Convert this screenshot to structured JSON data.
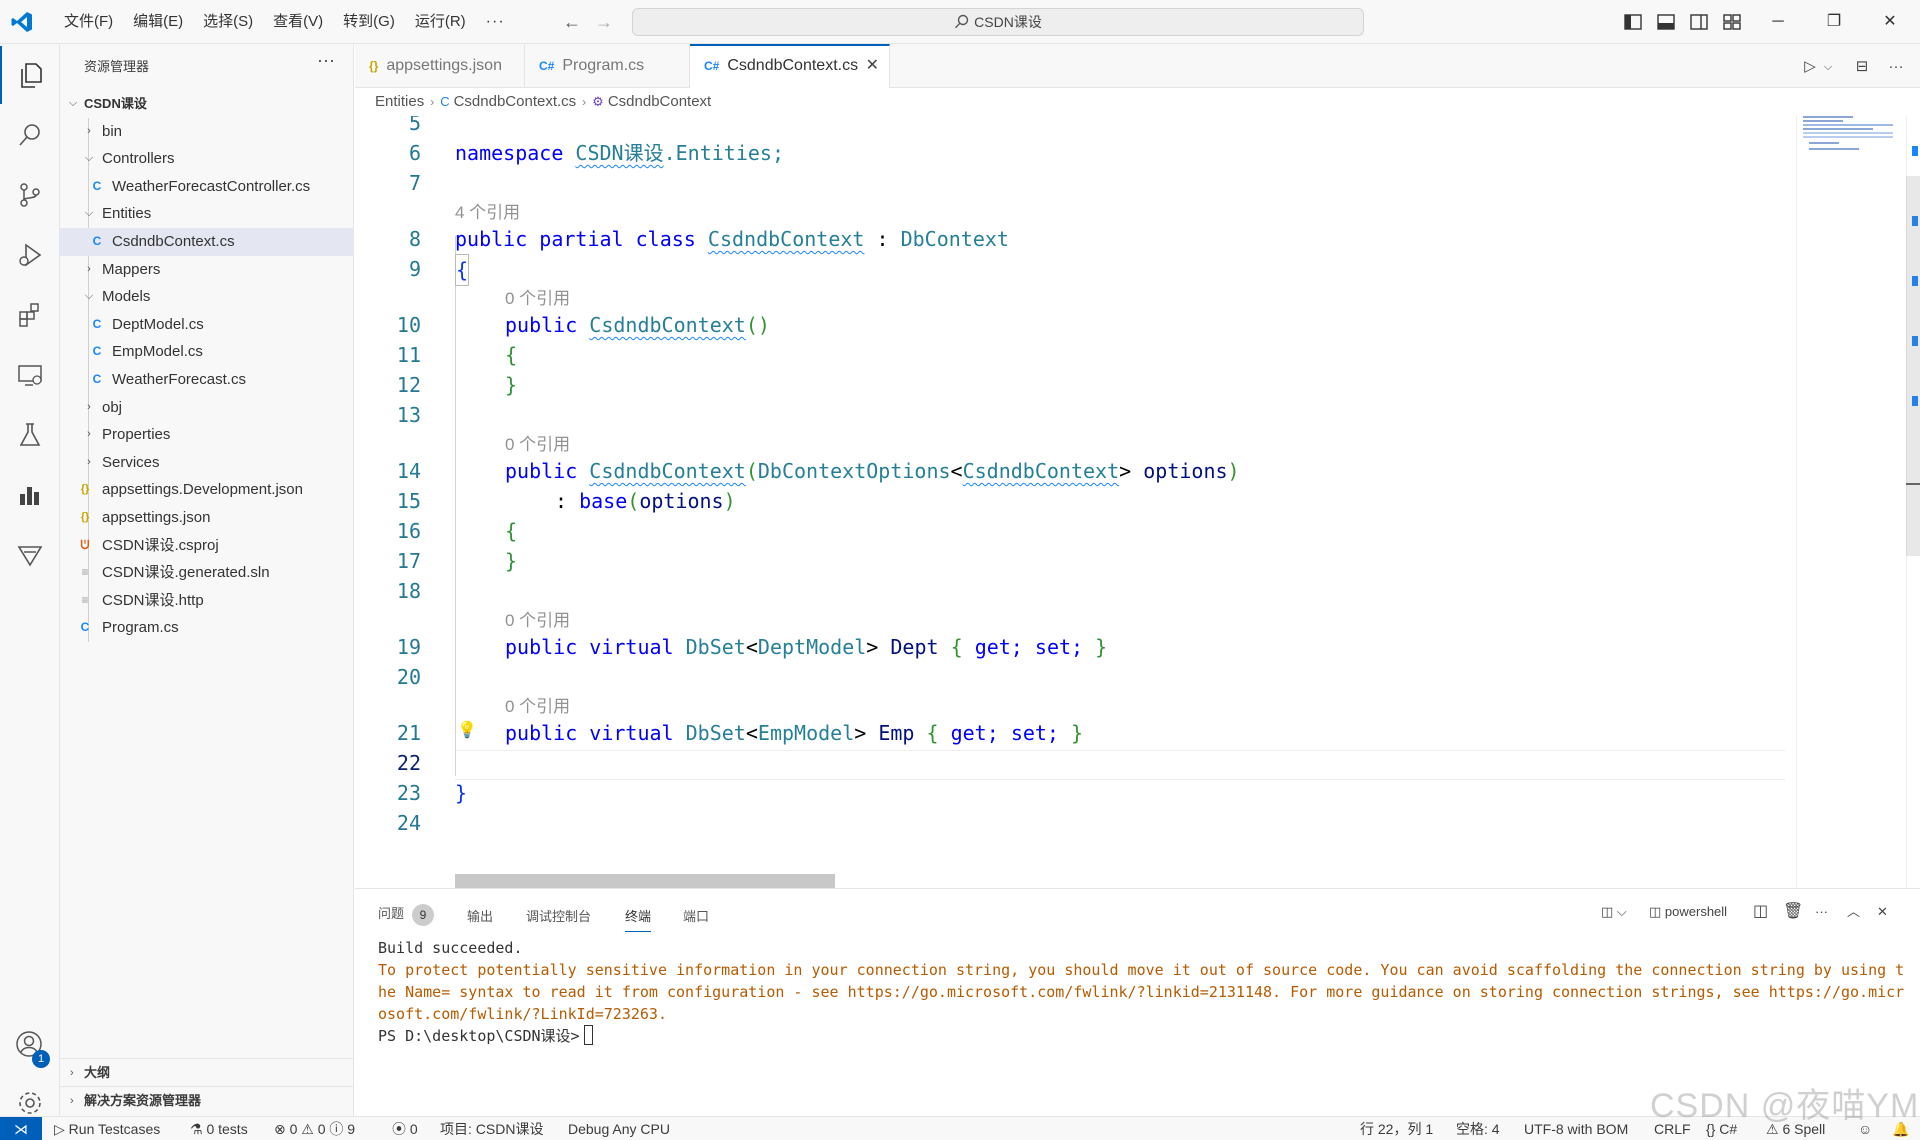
{
  "titlebar": {
    "menu": [
      "文件(F)",
      "编辑(E)",
      "选择(S)",
      "查看(V)",
      "转到(G)",
      "运行(R)",
      "···"
    ],
    "command_center": "CSDN课设"
  },
  "sidebar": {
    "title": "资源管理器",
    "more": "···",
    "root": "CSDN课设",
    "items": [
      {
        "label": "bin",
        "type": "folder"
      },
      {
        "label": "Controllers",
        "type": "folder-open"
      },
      {
        "label": "WeatherForecastController.cs",
        "type": "cs"
      },
      {
        "label": "Entities",
        "type": "folder-open"
      },
      {
        "label": "CsdndbContext.cs",
        "type": "cs"
      },
      {
        "label": "Mappers",
        "type": "folder"
      },
      {
        "label": "Models",
        "type": "folder-open"
      },
      {
        "label": "DeptModel.cs",
        "type": "cs"
      },
      {
        "label": "EmpModel.cs",
        "type": "cs"
      },
      {
        "label": "WeatherForecast.cs",
        "type": "cs"
      },
      {
        "label": "obj",
        "type": "folder"
      },
      {
        "label": "Properties",
        "type": "folder"
      },
      {
        "label": "Services",
        "type": "folder"
      },
      {
        "label": "appsettings.Development.json",
        "type": "json"
      },
      {
        "label": "appsettings.json",
        "type": "json"
      },
      {
        "label": "CSDN课设.csproj",
        "type": "rss"
      },
      {
        "label": "CSDN课设.generated.sln",
        "type": "text"
      },
      {
        "label": "CSDN课设.http",
        "type": "text"
      },
      {
        "label": "Program.cs",
        "type": "cs"
      }
    ],
    "outline": "大纲",
    "solution": "解决方案资源管理器"
  },
  "activity": {
    "accounts_badge": "1"
  },
  "tabs": [
    {
      "label": "appsettings.json",
      "icon": "{}"
    },
    {
      "label": "Program.cs",
      "icon": "C#"
    },
    {
      "label": "CsdndbContext.cs",
      "icon": "C#"
    }
  ],
  "breadcrumb": [
    "Entities",
    "CsdndbContext.cs",
    "CsdndbContext"
  ],
  "editor": {
    "line_numbers": [
      "5",
      "6",
      "7",
      "8",
      "9",
      "10",
      "11",
      "12",
      "13",
      "14",
      "15",
      "16",
      "17",
      "18",
      "19",
      "20",
      "21",
      "22",
      "23",
      "24"
    ],
    "code": {
      "ns_kw": "namespace",
      "ns_a": "CSDN课设",
      "ns_b": ".Entities;",
      "c_public": "public",
      "c_partial": "partial",
      "c_class": "class",
      "c_name": "CsdndbContext",
      "c_colon": ":",
      "c_base": "DbContext",
      "brace_open": "{",
      "brace_close": "}",
      "ctor_name": "CsdndbContext",
      "ctor_parens": "()",
      "ctor2_param_type": "DbContextOptions",
      "ctor2_lt": "<",
      "ctor2_gt": ">",
      "ctor2_param": "options",
      "base_colon": ":",
      "base_kw": "base",
      "virtual": "virtual",
      "dbset": "DbSet",
      "dept_model": "DeptModel",
      "dept": "Dept",
      "emp_model": "EmpModel",
      "emp": "Emp",
      "get": "get;",
      "set": "set;",
      "paren_open": "(",
      "paren_close": ")"
    },
    "lens_4": "4 个引用",
    "lens_0": "0 个引用"
  },
  "panel": {
    "tabs": [
      "问题",
      "输出",
      "调试控制台",
      "终端",
      "端口"
    ],
    "problems_count": "9",
    "shell": "powershell",
    "terminal": {
      "line1": "Build succeeded.",
      "warning": "To protect potentially sensitive information in your connection string, you should move it out of source code. You can avoid scaffolding the connection string by using the Name= syntax to read it from configuration - see https://go.microsoft.com/fwlink/?linkid=2131148. For more guidance on storing connection strings, see https://go.microsoft.com/fwlink/?LinkId=723263.",
      "prompt": "PS D:\\desktop\\CSDN课设>"
    }
  },
  "statusbar": {
    "run_testcases": "Run Testcases",
    "tests": "0 tests",
    "problems": "⊗ 0 ⚠ 0 ⓘ 9",
    "ports": "0",
    "project": "项目: CSDN课设",
    "debug": "Debug Any CPU",
    "position": "行 22，列 1",
    "spaces": "空格: 4",
    "encoding": "UTF-8 with BOM",
    "eol": "CRLF",
    "language": "C#",
    "spell": "6 Spell"
  },
  "watermark": "CSDN @夜喵YM",
  "colors": {
    "accent": "#005fb8",
    "keyword": "#0000ff",
    "type": "#267f99",
    "warning": "#b65b00"
  }
}
